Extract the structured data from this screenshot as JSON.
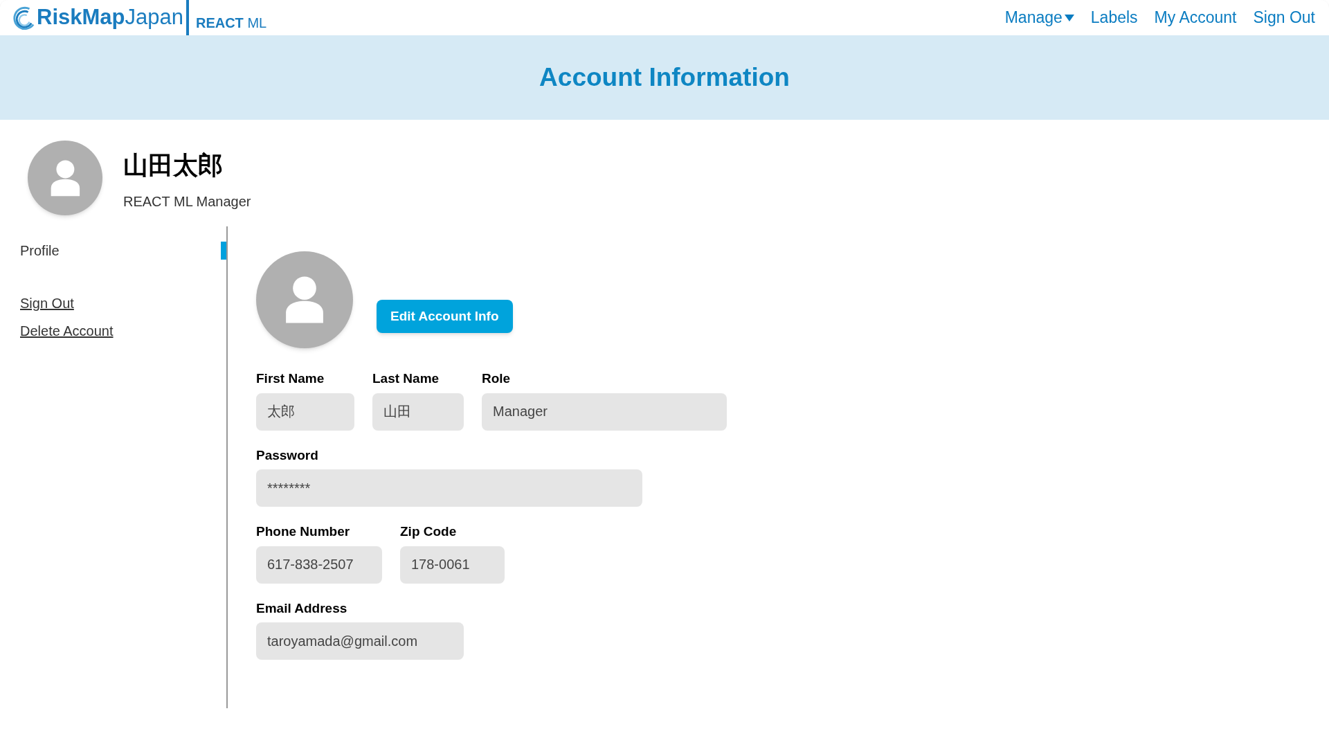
{
  "header": {
    "brand_bold": "RiskMap",
    "brand_light": "Japan",
    "product_bold": "REACT",
    "product_light": "ML",
    "nav": [
      {
        "label": "Manage",
        "dropdown": true
      },
      {
        "label": "Labels",
        "dropdown": false
      },
      {
        "label": "My Account",
        "dropdown": false
      },
      {
        "label": "Sign Out",
        "dropdown": false
      }
    ]
  },
  "banner": {
    "title": "Account Information"
  },
  "profile": {
    "name": "山田太郎",
    "subtitle": "REACT ML Manager"
  },
  "sidebar": {
    "items": [
      {
        "label": "Profile",
        "kind": "tab",
        "selected": true
      },
      {
        "label": "Sign Out",
        "kind": "link",
        "selected": false
      },
      {
        "label": "Delete Account",
        "kind": "link",
        "selected": false
      }
    ]
  },
  "edit_button": "Edit Account Info",
  "form": {
    "rows": [
      [
        {
          "label": "First Name",
          "value": "太郎"
        },
        {
          "label": "Last Name",
          "value": "山田"
        },
        {
          "label": "Role",
          "value": "Manager"
        }
      ],
      [
        {
          "label": "Password",
          "value": "********"
        }
      ],
      [
        {
          "label": "Phone Number",
          "value": "617-838-2507"
        },
        {
          "label": "Zip Code",
          "value": "178-0061"
        }
      ],
      [
        {
          "label": "Email Address",
          "value": "taroyamada@gmail.com"
        }
      ]
    ]
  }
}
